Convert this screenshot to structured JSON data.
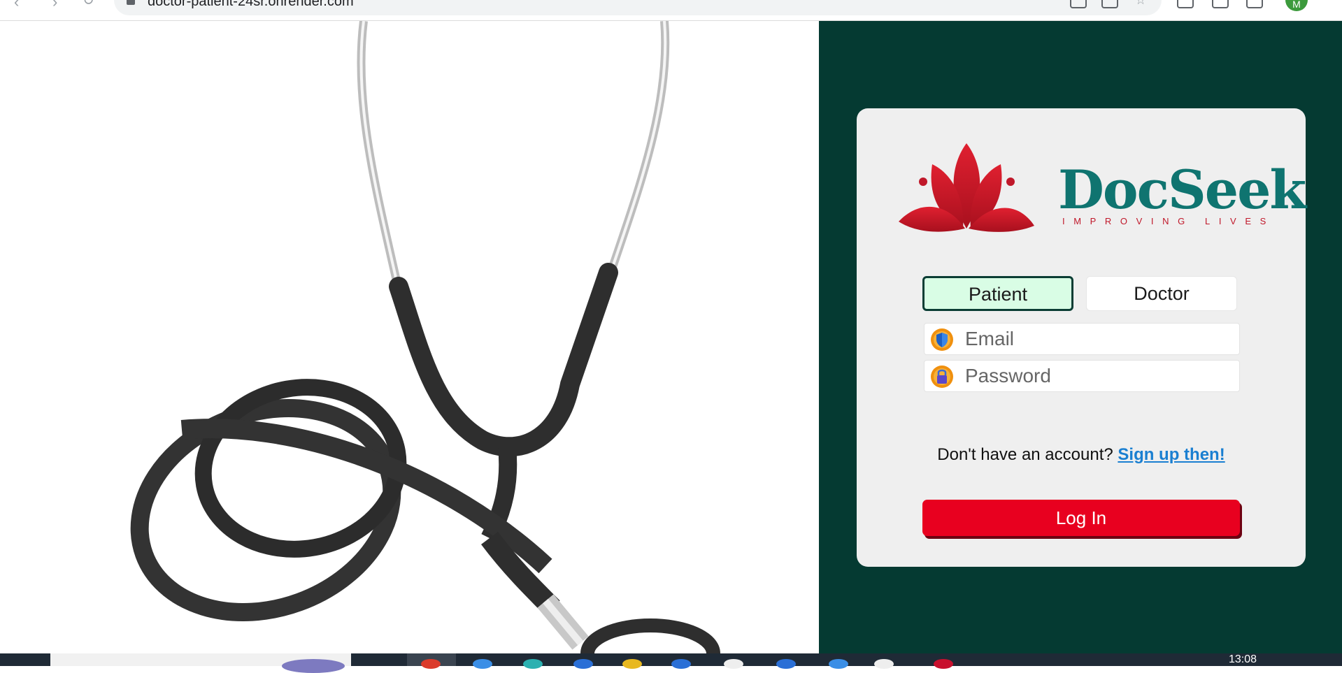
{
  "browser": {
    "url": "doctor-patient-24sr.onrender.com",
    "profile_initial": "M"
  },
  "brand": {
    "name": "DocSeek",
    "tagline": "IMPROVING LIVES",
    "name_color": "#0f7470",
    "accent_color": "#c0182a"
  },
  "login": {
    "roles": [
      {
        "label": "Patient",
        "selected": true
      },
      {
        "label": "Doctor",
        "selected": false
      }
    ],
    "email_placeholder": "Email",
    "password_placeholder": "Password",
    "signup_prompt": "Don't have an account?",
    "signup_link": "Sign up then!",
    "submit_label": "Log In",
    "submit_color": "#e8001f",
    "panel_color": "#053a32"
  },
  "taskbar": {
    "clock": "13:08"
  }
}
